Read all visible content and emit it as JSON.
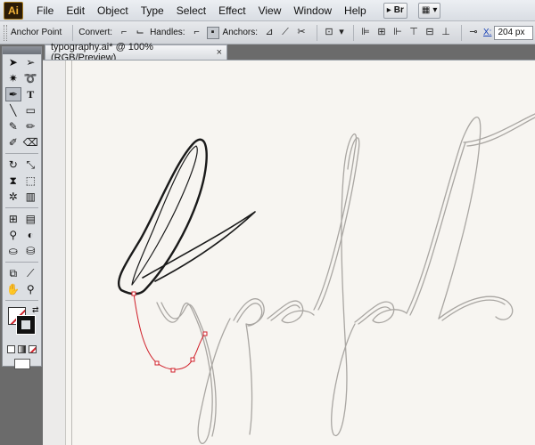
{
  "app": {
    "logo": "Ai"
  },
  "menu": [
    "File",
    "Edit",
    "Object",
    "Type",
    "Select",
    "Effect",
    "View",
    "Window",
    "Help"
  ],
  "menu_tools": {
    "bridge_label": "Br"
  },
  "control_bar": {
    "anchor_point_label": "Anchor Point",
    "convert_label": "Convert:",
    "handles_label": "Handles:",
    "anchors_label": "Anchors:",
    "x_label": "X:",
    "x_value": "204 px"
  },
  "document": {
    "tab_title": "typography.ai* @ 100% (RGB/Preview)",
    "close_glyph": "×"
  },
  "colors": {
    "accent_path": "#d0202a",
    "sketch_stroke": "#a9a6a2",
    "ink_stroke": "#1a1a1a"
  },
  "tools": [
    [
      "selection-icon",
      "direct-selection-icon"
    ],
    [
      "magic-wand-icon",
      "lasso-icon"
    ],
    [
      "pen-icon",
      "type-icon"
    ],
    [
      "line-segment-icon",
      "rectangle-icon"
    ],
    [
      "paintbrush-icon",
      "pencil-icon"
    ],
    [
      "blob-brush-icon",
      "eraser-icon"
    ],
    [
      "rotate-icon",
      "scale-icon"
    ],
    [
      "width-icon",
      "free-transform-icon"
    ],
    [
      "symbol-sprayer-icon",
      "column-graph-icon"
    ],
    [
      "mesh-icon",
      "gradient-icon"
    ],
    [
      "eyedropper-icon",
      "blend-icon"
    ],
    [
      "live-paint-icon",
      "live-paint-selection-icon"
    ],
    [
      "artboard-icon",
      "slice-icon"
    ],
    [
      "hand-icon",
      "zoom-icon"
    ]
  ]
}
